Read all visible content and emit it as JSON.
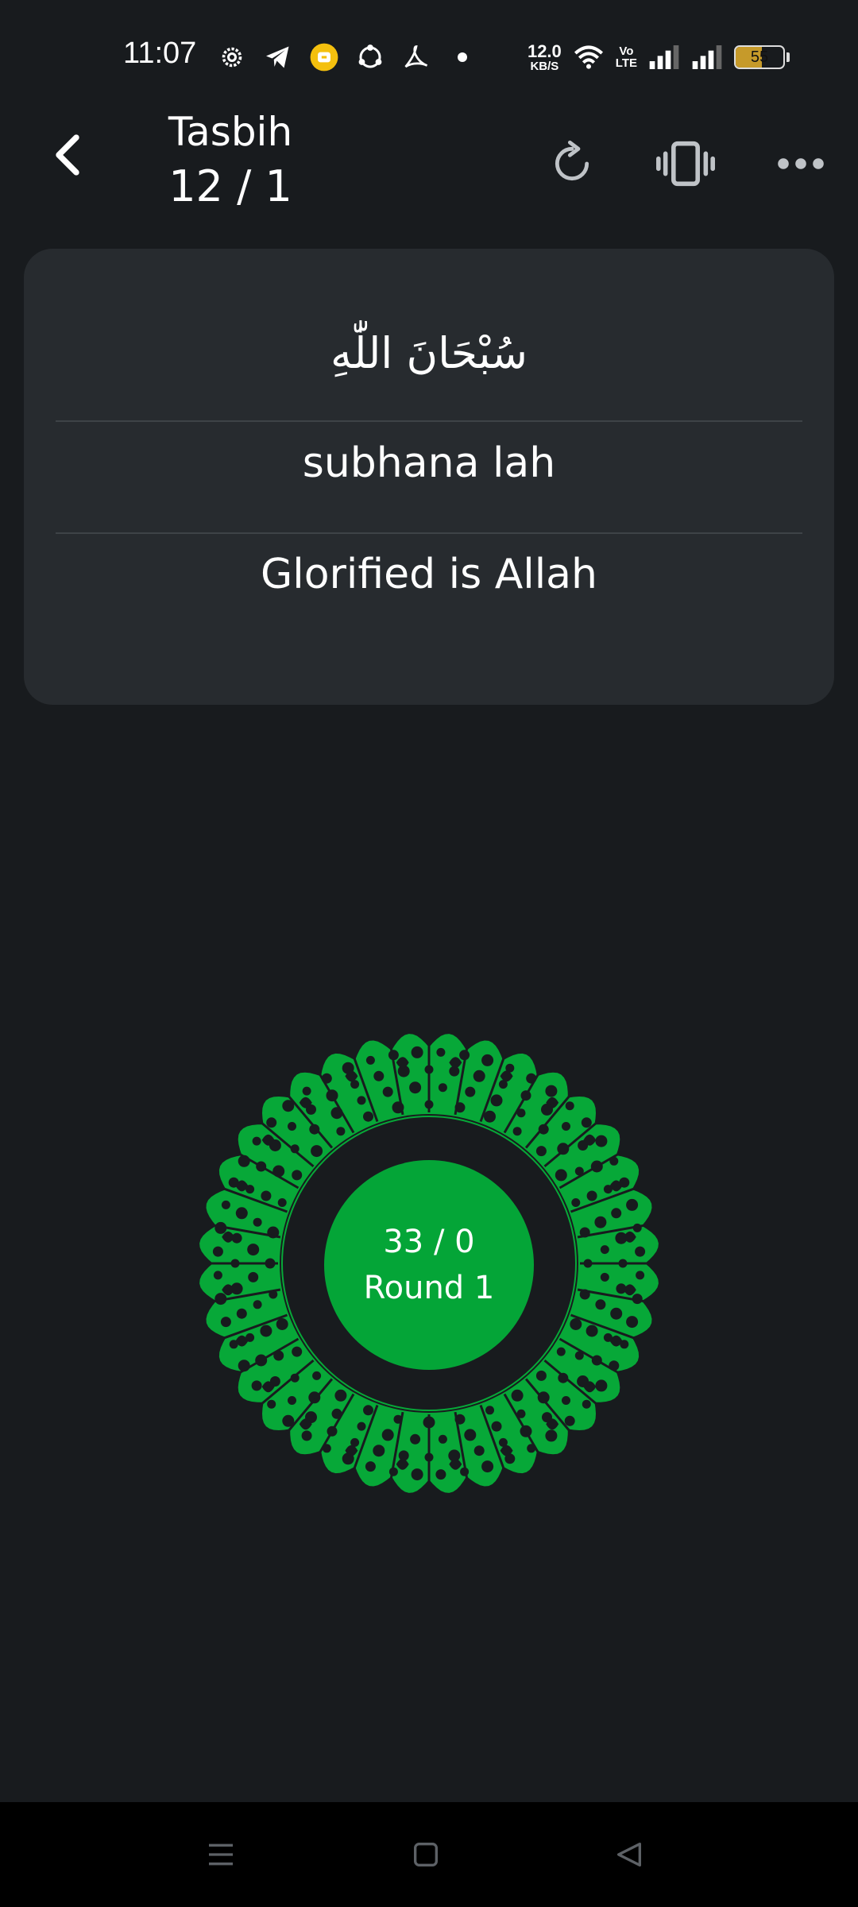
{
  "status_bar": {
    "time": "11:07",
    "net_speed_value": "12.0",
    "net_speed_unit": "KB/S",
    "volte_top": "Vo",
    "volte_bottom": "LTE",
    "battery_level": "55",
    "battery_fraction": 0.55,
    "left_icons": [
      "settings-gear-icon",
      "telegram-icon",
      "notification-app-icon",
      "share-it-icon",
      "pdf-reader-icon",
      "dot-icon"
    ],
    "right_icons": [
      "wifi-icon",
      "signal-icon",
      "signal-icon",
      "battery-icon"
    ]
  },
  "header": {
    "title": "Tasbih",
    "counter": "12 / 1",
    "actions": [
      "back-icon",
      "reset-icon",
      "vibrate-icon",
      "more-icon"
    ]
  },
  "dhikr": {
    "arabic": "سُبْحَانَ اللّٰهِ",
    "transliteration": "subhana lah",
    "meaning": "Glorified is Allah"
  },
  "counter_button": {
    "count": "33 / 0",
    "round": "Round 1"
  },
  "colors": {
    "background": "#181b1e",
    "card": "#272b2f",
    "accent_green": "#04a537",
    "ornament_green": "#07a838"
  },
  "nav_bar": {
    "buttons": [
      "menu-icon",
      "home-icon",
      "back-triangle-icon"
    ]
  }
}
